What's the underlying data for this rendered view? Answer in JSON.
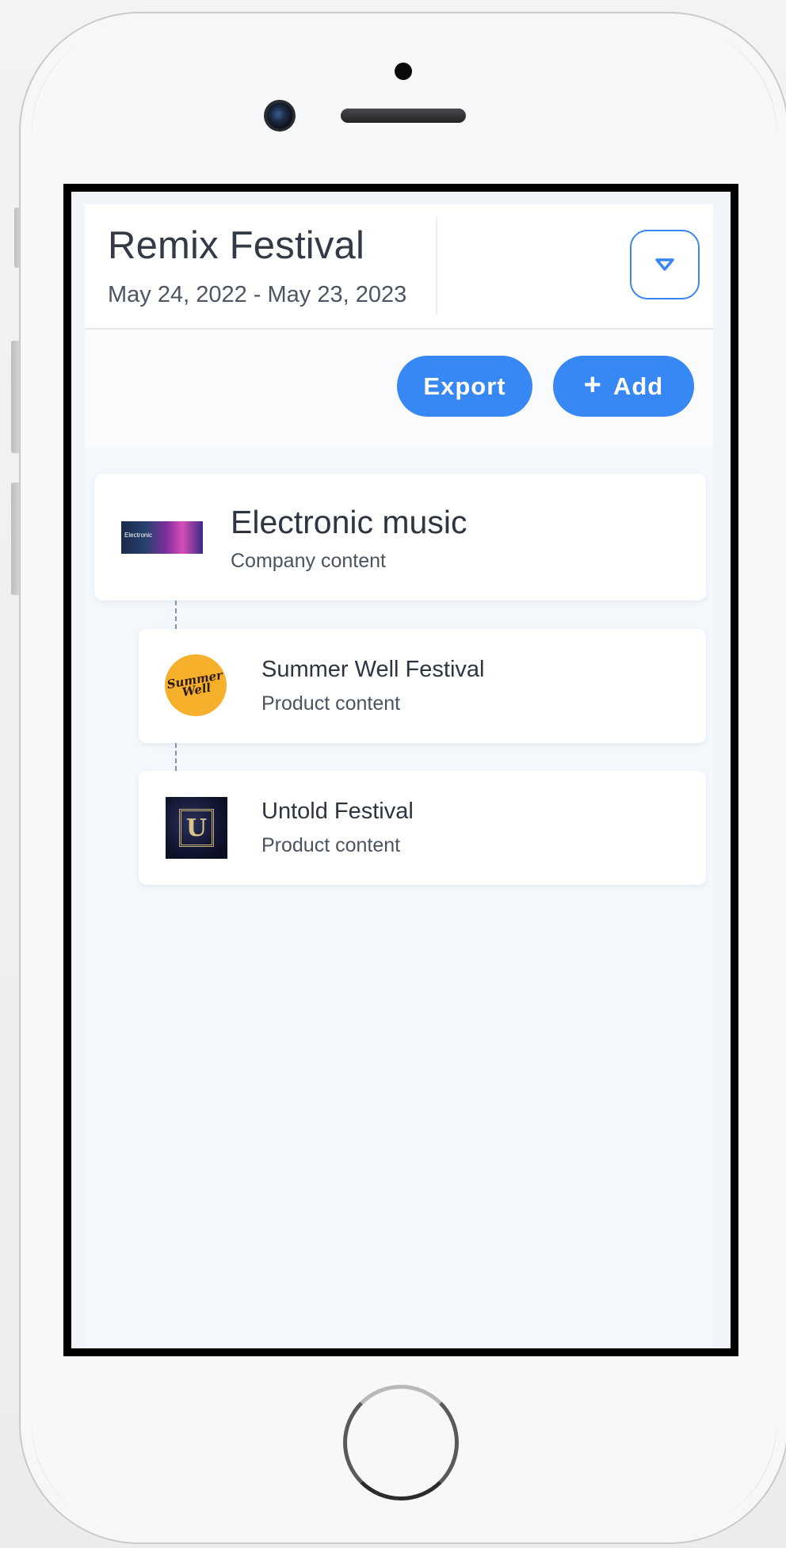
{
  "header": {
    "title": "Remix Festival",
    "date_range": "May 24, 2022 - May 23, 2023"
  },
  "toolbar": {
    "export_label": "Export",
    "add_label": "Add",
    "add_icon": "plus-icon"
  },
  "tree": {
    "company": {
      "title": "Electronic music",
      "subtitle": "Company content",
      "thumb_text": "Electronic"
    },
    "products": [
      {
        "title": "Summer Well Festival",
        "subtitle": "Product content",
        "thumb_text": "Summer Well"
      },
      {
        "title": "Untold Festival",
        "subtitle": "Product content",
        "thumb_text": "U"
      }
    ]
  },
  "colors": {
    "accent": "#3787f5",
    "background": "#f4f8fc",
    "card": "#ffffff",
    "text_primary": "#2f3540",
    "summer_logo": "#f7b02c"
  },
  "icons": {
    "dropdown": "caret-down-icon"
  }
}
